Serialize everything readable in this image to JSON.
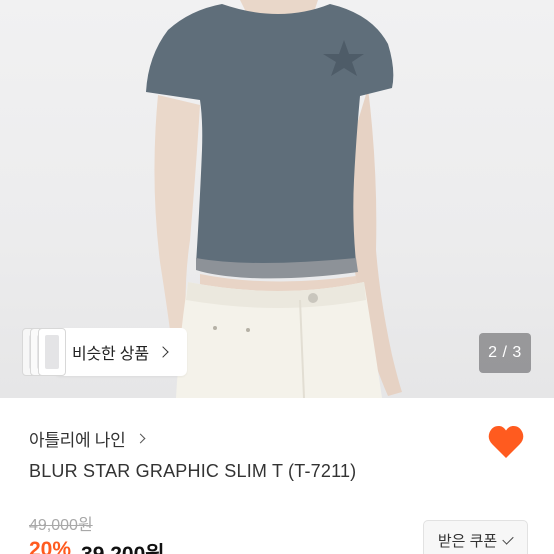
{
  "product_image": {
    "alt": "product photo",
    "slide_current": "2",
    "slide_total": "3",
    "slide_indicator": "2 / 3"
  },
  "similar": {
    "label": "비슷한 상품"
  },
  "brand": {
    "name": "아틀리에 나인"
  },
  "product": {
    "title": "BLUR STAR GRAPHIC SLIM T (T-7211)",
    "original_price": "49,000원",
    "discount": "20%",
    "price": "39,200원"
  },
  "coupon": {
    "label": "받은 쿠폰"
  },
  "colors": {
    "accent": "#ff5b1f",
    "heart": "#ff5b1f",
    "shirt": "#5f6e7a",
    "pants": "#f4f2ea"
  },
  "icons": {
    "favorite": "heart-icon",
    "brand_link": "chevron-right-icon",
    "similar_link": "chevron-right-icon",
    "coupon_state": "check-icon"
  }
}
